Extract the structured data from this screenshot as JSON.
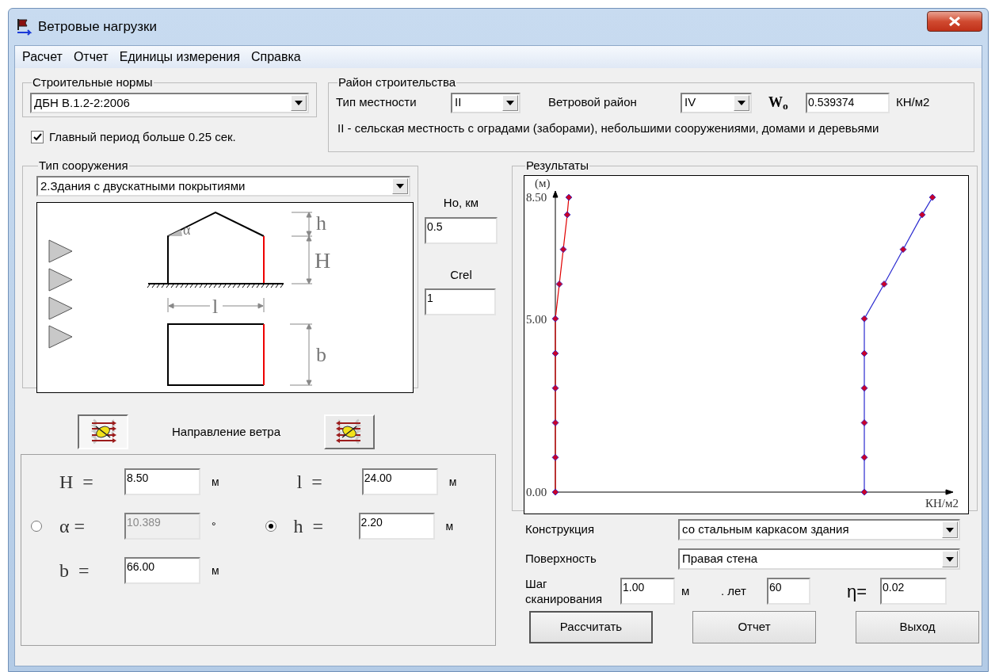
{
  "window": {
    "title": "Ветровые нагрузки"
  },
  "menu": [
    {
      "label": "Расчет"
    },
    {
      "label": "Отчет"
    },
    {
      "label": "Единицы измерения"
    },
    {
      "label": "Справка"
    }
  ],
  "building_codes": {
    "legend": "Строительные нормы",
    "value": "ДБН В.1.2-2:2006"
  },
  "main_period": {
    "label": "Главный период больше 0.25 сек.",
    "checked": true
  },
  "region": {
    "legend": "Район строительства",
    "terrain_label": "Тип местности",
    "terrain_value": "II",
    "wind_region_label": "Ветровой район",
    "wind_region_value": "IV",
    "w0_symbol": "W$_{o}$",
    "w0_value": "0.539374",
    "w0_unit": "КН/м2",
    "description": "II -  сельская местность с оградами (заборами), небольшими сооружениями, домами и деревьями"
  },
  "structure": {
    "legend": "Тип сооружения",
    "value": "2.Здания с двускатными покрытиями",
    "diagram_labels": {
      "alpha": "α",
      "h": "h",
      "H": "H",
      "l": "l",
      "b": "b"
    }
  },
  "ho": {
    "label": "Ho, км",
    "value": "0.5"
  },
  "crel": {
    "label": "Crel",
    "value": "1"
  },
  "wind_direction": {
    "label": "Направление ветра",
    "buttons": [
      {
        "kind": "right",
        "selected": true
      },
      {
        "kind": "left",
        "selected": false
      }
    ]
  },
  "params": [
    [
      {
        "kind": "plain",
        "label": "H  =",
        "value": "8.50",
        "unit": "м",
        "disabled": false
      },
      {
        "kind": "plain",
        "label": "l  =",
        "value": "24.00",
        "unit": "м",
        "disabled": false
      }
    ],
    [
      {
        "kind": "radio",
        "selected": false,
        "label": "α =",
        "value": "10.389",
        "unit": "°",
        "disabled": true
      },
      {
        "kind": "radio",
        "selected": true,
        "label": "h  =",
        "value": "2.20",
        "unit": "м",
        "disabled": false
      }
    ],
    [
      {
        "kind": "plain",
        "label": "b  =",
        "value": "66.00",
        "unit": "м",
        "disabled": false
      }
    ]
  ],
  "results": {
    "legend": "Результаты",
    "y_unit": "(м)",
    "y_ticks": [
      "8.50",
      "5.00",
      "0.00"
    ],
    "x_unit": "КН/м2"
  },
  "construction": {
    "label": "Конструкция",
    "value": "со стальным каркасом здания"
  },
  "surface": {
    "label": "Поверхность",
    "value": "Правая стена"
  },
  "scan": {
    "label": "Шаг сканирования",
    "value": "1.00",
    "unit": "м"
  },
  "years": {
    "label": ". лет",
    "value": "60"
  },
  "eta": {
    "label": "η=",
    "value": "0.02"
  },
  "buttons": [
    {
      "label": "Рассчитать",
      "default": true
    },
    {
      "label": "Отчет",
      "default": false
    },
    {
      "label": "Выход",
      "default": false
    }
  ]
}
